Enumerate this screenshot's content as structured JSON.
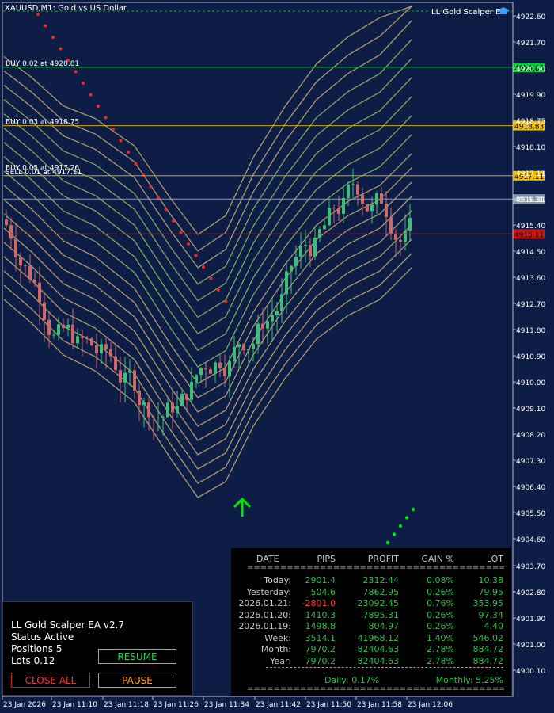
{
  "chart": {
    "symbol_title": "XAUUSD,M1: Gold vs US Dollar",
    "ea_label": "LL Gold Scalper EA",
    "price_ticks": [
      "4922.60",
      "4921.70",
      "4920.50",
      "4919.90",
      "4918.75",
      "4918.10",
      "4917.11",
      "4916.31",
      "4915.40",
      "4914.50",
      "4913.60",
      "4912.70",
      "4911.80",
      "4910.90",
      "4910.00",
      "4909.10",
      "4908.20",
      "4907.30",
      "4906.40",
      "4905.50",
      "4904.60",
      "4903.70",
      "4902.80",
      "4901.90",
      "4901.00",
      "4900.10"
    ],
    "time_ticks": [
      "23 Jan 2026",
      "23 Jan 11:10",
      "23 Jan 11:18",
      "23 Jan 11:26",
      "23 Jan 11:34",
      "23 Jan 11:42",
      "23 Jan 11:50",
      "23 Jan 11:58",
      "23 Jan 12:06"
    ],
    "badges": [
      {
        "text": "4920.83",
        "color": "#00cc33",
        "price": 4920.83
      },
      {
        "text": "4918.83",
        "color": "#f0c000",
        "price": 4918.83
      },
      {
        "text": "4917.11",
        "color": "#f0c000",
        "price": 4917.11
      },
      {
        "text": "4916.31",
        "color": "#8896aa",
        "price": 4916.31
      },
      {
        "text": "4915.11",
        "color": "#cc1111",
        "price": 4915.11
      }
    ],
    "trade_labels": [
      {
        "text": "BUY 0.02 at 4920.81",
        "price": 4920.83
      },
      {
        "text": "BUY 0.03 at 4918.75",
        "price": 4918.83
      },
      {
        "text": "BUY 0.05 at 4917.26",
        "price": 4917.26
      },
      {
        "text": "SELL 0.01 at 4917.11",
        "price": 4917.11
      }
    ],
    "colors": {
      "background": "#0d1d45",
      "bull": "#3fbf76",
      "bear": "#c8696a",
      "ribbon": "#c8b27a",
      "ribbon_green": "#8ec26a",
      "sar": "#ff2020",
      "arrow": "#00e600"
    }
  },
  "ea_panel": {
    "title": "LL Gold Scalper EA",
    "version": "v2.7",
    "status_label": "Status",
    "status_value": "Active",
    "positions_label": "Positions",
    "positions_value": "5",
    "lots_label": "Lots",
    "lots_value": "0.12",
    "resume_label": "RESUME",
    "close_all_label": "CLOSE ALL",
    "pause_label": "PAUSE"
  },
  "stats": {
    "headers": [
      "DATE",
      "PIPS",
      "PROFIT",
      "GAIN %",
      "LOT"
    ],
    "separator": "=======================================",
    "rows": [
      {
        "date": "Today:",
        "pips": "2901.4",
        "profit": "2312.44",
        "gain": "0.08%",
        "lot": "10.38",
        "neg": false
      },
      {
        "date": "Yesterday:",
        "pips": "504.6",
        "profit": "7862.95",
        "gain": "0.26%",
        "lot": "79.95",
        "neg": false
      },
      {
        "date": "2026.01.21:",
        "pips": "-2801.0",
        "profit": "23092.45",
        "gain": "0.76%",
        "lot": "353.95",
        "neg": true
      },
      {
        "date": "2026.01.20:",
        "pips": "1410.3",
        "profit": "7895.31",
        "gain": "0.26%",
        "lot": "97.34",
        "neg": false
      },
      {
        "date": "2026.01.19:",
        "pips": "1498.8",
        "profit": "804.97",
        "gain": "0.26%",
        "lot": "4.40",
        "neg": false
      },
      {
        "date": "Week:",
        "pips": "3514.1",
        "profit": "41968.12",
        "gain": "1.40%",
        "lot": "546.02",
        "neg": false
      },
      {
        "date": "Month:",
        "pips": "7970.2",
        "profit": "82404.63",
        "gain": "2.78%",
        "lot": "884.72",
        "neg": false
      },
      {
        "date": "Year:",
        "pips": "7970.2",
        "profit": "82404.63",
        "gain": "2.78%",
        "lot": "884.72",
        "neg": false
      }
    ],
    "daily": "Daily: 0.17%",
    "monthly": "Monthly: 5.25%"
  }
}
